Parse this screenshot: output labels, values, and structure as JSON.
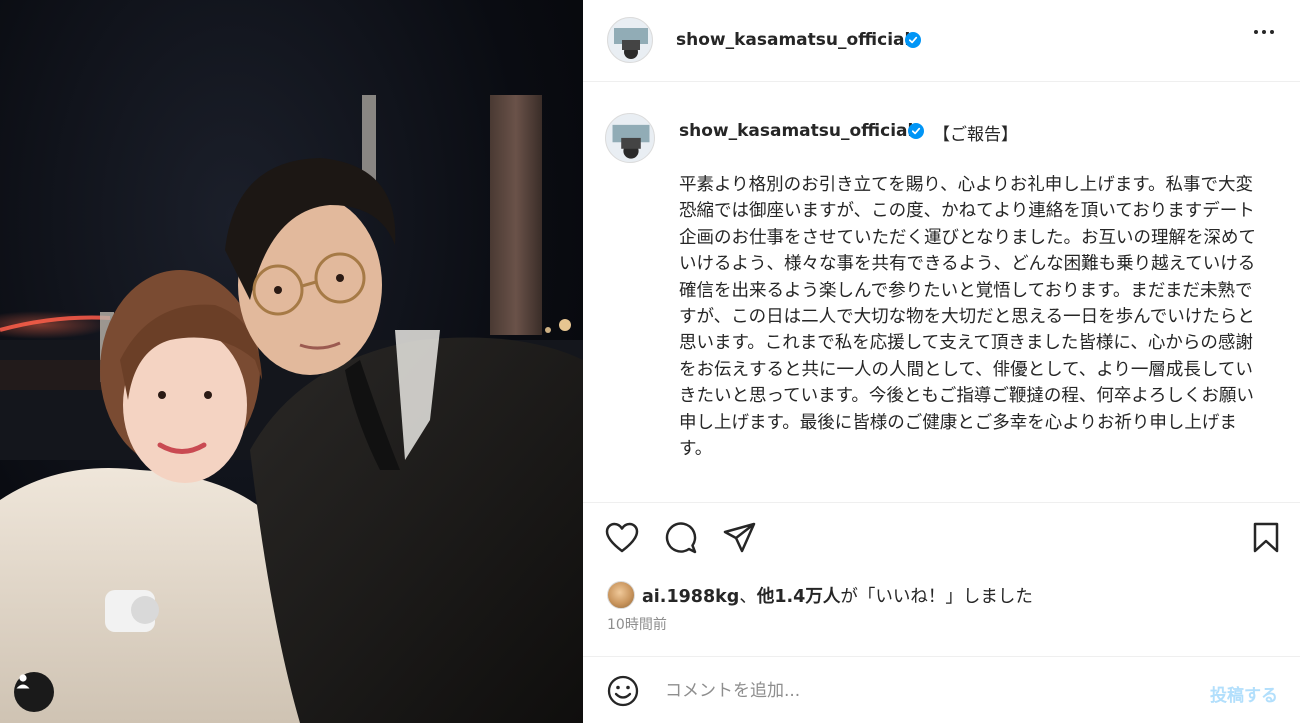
{
  "post": {
    "username": "show_kasamatsu_official",
    "report_label": "【ご報告】",
    "caption": "平素より格別のお引き立てを賜り、心よりお礼申し上げます。私事で大変恐縮では御座いますが、この度、かねてより連絡を頂いておりますデート企画のお仕事をさせていただく運びとなりました。お互いの理解を深めていけるよう、様々な事を共有できるよう、どんな困難も乗り越えていける確信を出来るよう楽しんで参りたいと覚悟しております。まだまだ未熟ですが、この日は二人で大切な物を大切だと思える一日を歩んでいけたらと思います。これまで私を応援して支えて頂きました皆様に、心からの感謝をお伝えすると共に一人の人間として、俳優として、より一層成長していきたいと思っています。今後ともご指導ご鞭撻の程、何卒よろしくお願い申し上げます。最後に皆様のご健康とご多幸を心よりお祈り申し上げます。",
    "likes": {
      "liker": "ai.1988kg",
      "separator": "、",
      "others": "他1.4万人",
      "suffix": "が「いいね！」しました"
    },
    "time_ago": "10時間前"
  },
  "comment": {
    "placeholder": "コメントを追加...",
    "post_label": "投稿する"
  },
  "icons": {
    "like": "heart-icon",
    "comment": "comment-icon",
    "share": "send-icon",
    "save": "bookmark-icon",
    "emoji": "emoji-icon",
    "more": "more-icon",
    "tag": "user-tag-icon",
    "verified": "verified-badge-icon"
  },
  "colors": {
    "verified": "#0095f6",
    "post_button_disabled": "#b2dffc",
    "muted_text": "#8e8e8e"
  }
}
